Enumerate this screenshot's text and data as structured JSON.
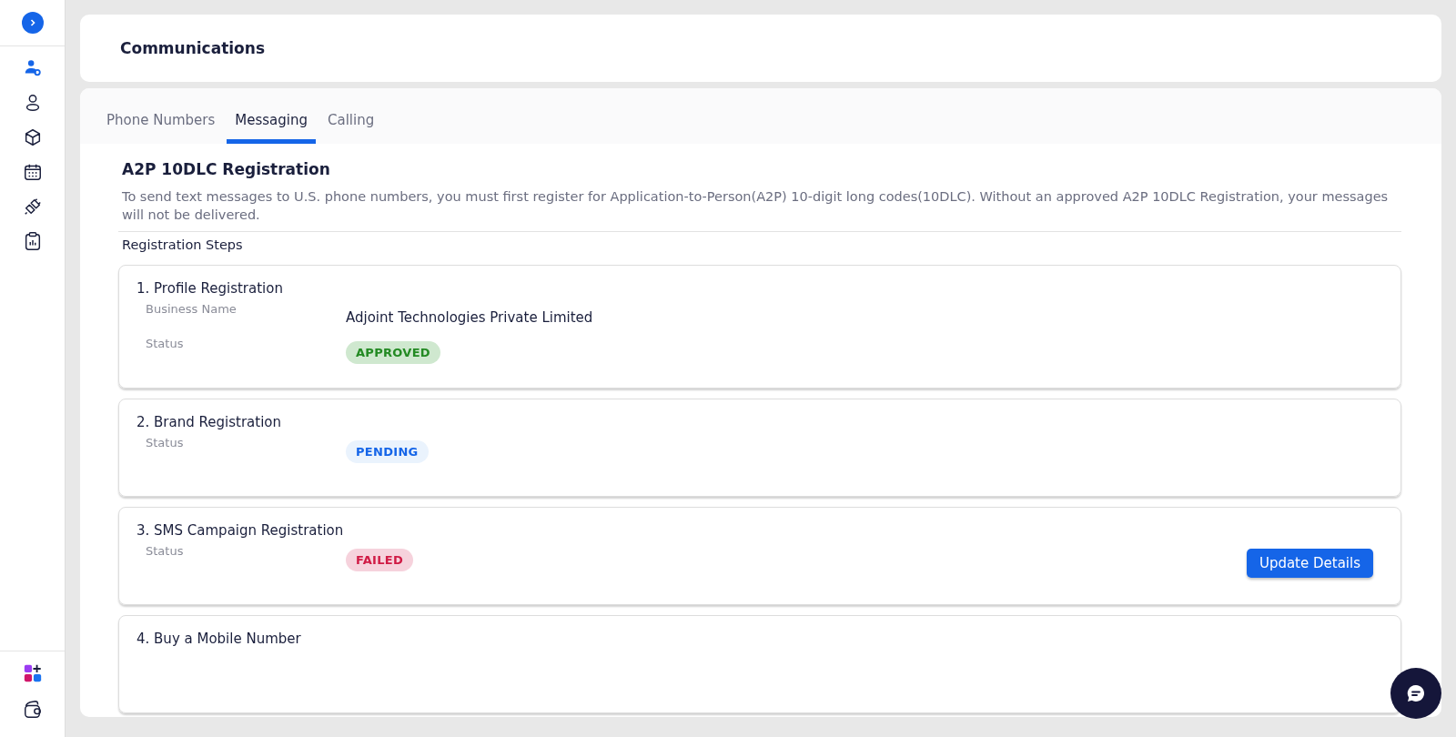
{
  "sidebar": {
    "items": [
      {
        "selected": true
      },
      {
        "selected": false
      },
      {
        "selected": false
      },
      {
        "selected": false
      },
      {
        "selected": false
      },
      {
        "selected": false
      }
    ]
  },
  "header": {
    "title": "Communications"
  },
  "tabs": [
    {
      "label": "Phone Numbers",
      "selected": false
    },
    {
      "label": "Messaging",
      "selected": true
    },
    {
      "label": "Calling",
      "selected": false
    }
  ],
  "section": {
    "title": "A2P 10DLC Registration",
    "description": "To send text messages to U.S. phone numbers, you must first register for Application-to-Person(A2P) 10-digit long codes(10DLC). Without an approved A2P 10DLC Registration, your messages will not be delivered.",
    "steps_heading": "Registration Steps"
  },
  "steps": [
    {
      "title": "1. Profile Registration",
      "fields": [
        {
          "label": "Business Name",
          "kind": "text",
          "value": "Adjoint Technologies Private Limited"
        },
        {
          "label": "Status",
          "kind": "approved",
          "value": "APPROVED"
        }
      ]
    },
    {
      "title": "2. Brand Registration",
      "fields": [
        {
          "label": "Status",
          "kind": "pending",
          "value": "PENDING"
        }
      ]
    },
    {
      "title": "3. SMS Campaign Registration",
      "fields": [
        {
          "label": "Status",
          "kind": "failed",
          "value": "FAILED"
        }
      ],
      "button": "Update Details"
    },
    {
      "title": "4. Buy a Mobile Number"
    }
  ]
}
